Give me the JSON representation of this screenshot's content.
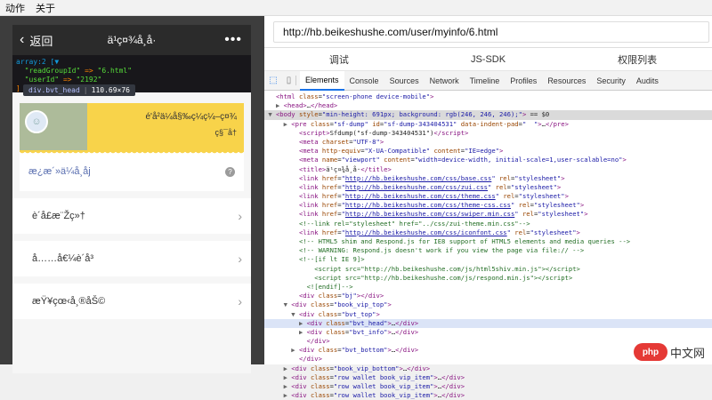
{
  "menubar": {
    "items": [
      "动作",
      "关于"
    ]
  },
  "phone": {
    "nav": {
      "back_label": "返回",
      "title": "ä¹ç¤¾å¸å·",
      "more": "•••"
    },
    "dump": {
      "header": "array:2 [▼",
      "line1_key": "\"readGroupId\"",
      "line1_val": "\"6.html\"",
      "line2_key": "\"userId\"",
      "line2_val": "\"2192\"",
      "close": "]"
    },
    "tooltip": {
      "tag": "div.bvt_head",
      "size": "110.69×76"
    },
    "vip": {
      "info_line1": "é'å²ä¼å§‰ç¼ç¼–ç¤¾",
      "info_line2": "ç§¯å†",
      "bottom_label": "æ¿æ´»ä¼å¸åj",
      "help": "?"
    },
    "rows": [
      {
        "label": "è´å£æ¨Žç»†"
      },
      {
        "label": "å……å€¼è´å³"
      },
      {
        "label": "æŸ¥çœ‹å¸®åŠ©"
      }
    ]
  },
  "browser": {
    "url": "http://hb.beikeshushe.com/user/myinfo/6.html",
    "tabs": [
      "调试",
      "JS-SDK",
      "权限列表"
    ],
    "devtools_tabs": [
      "Elements",
      "Console",
      "Sources",
      "Network",
      "Timeline",
      "Profiles",
      "Resources",
      "Security",
      "Audits"
    ],
    "code_lines": [
      {
        "indent": 0,
        "arrow": "",
        "html": "<span class='tg'>&lt;html</span> <span class='at'>class</span>=<span class='av'>\"screen-phone device-mobile\"</span><span class='tg'>&gt;</span>"
      },
      {
        "indent": 1,
        "arrow": "▶",
        "html": "<span class='tg'>&lt;head&gt;</span>…<span class='tg'>&lt;/head&gt;</span>"
      },
      {
        "indent": 0,
        "arrow": "▼",
        "cls": "sel",
        "html": "<span class='tg'>&lt;body</span> <span class='at'>style</span>=<span class='av'>\"min-height: 691px; background: rgb(246, 246, 246);\"</span><span class='tg'>&gt;</span> == $0"
      },
      {
        "indent": 2,
        "arrow": "▶",
        "html": "<span class='tg'>&lt;pre</span> <span class='at'>class</span>=<span class='av'>\"sf-dump\"</span> <span class='at'>id</span>=<span class='av'>\"sf-dump-343404531\"</span> <span class='at'>data-indent-pad</span>=<span class='av'>\"  \"</span><span class='tg'>&gt;</span>…<span class='tg'>&lt;/pre&gt;</span>"
      },
      {
        "indent": 3,
        "arrow": "",
        "html": "<span class='tg'>&lt;script&gt;</span>Sfdump(\"sf-dump-343404531\")<span class='tg'>&lt;/script&gt;</span>"
      },
      {
        "indent": 3,
        "arrow": "",
        "html": "<span class='tg'>&lt;meta</span> <span class='at'>charset</span>=<span class='av'>\"UTF-8\"</span><span class='tg'>&gt;</span>"
      },
      {
        "indent": 3,
        "arrow": "",
        "html": "<span class='tg'>&lt;meta</span> <span class='at'>http-equiv</span>=<span class='av'>\"X-UA-Compatible\"</span> <span class='at'>content</span>=<span class='av'>\"IE=edge\"</span><span class='tg'>&gt;</span>"
      },
      {
        "indent": 3,
        "arrow": "",
        "html": "<span class='tg'>&lt;meta</span> <span class='at'>name</span>=<span class='av'>\"viewport\"</span> <span class='at'>content</span>=<span class='av'>\"width=device-width, initial-scale=1,user-scalable=no\"</span><span class='tg'>&gt;</span>"
      },
      {
        "indent": 3,
        "arrow": "",
        "html": "<span class='tg'>&lt;title&gt;</span>ä¹ç¤¾å¸å·<span class='tg'>&lt;/title&gt;</span>"
      },
      {
        "indent": 3,
        "arrow": "",
        "html": "<span class='tg'>&lt;link</span> <span class='at'>href</span>=<span class='av'>\"</span><span class='lk'>http://hb.beikeshushe.com/css/base.css</span><span class='av'>\"</span> <span class='at'>rel</span>=<span class='av'>\"stylesheet\"</span><span class='tg'>&gt;</span>"
      },
      {
        "indent": 3,
        "arrow": "",
        "html": "<span class='tg'>&lt;link</span> <span class='at'>href</span>=<span class='av'>\"</span><span class='lk'>http://hb.beikeshushe.com/css/zui.css</span><span class='av'>\"</span> <span class='at'>rel</span>=<span class='av'>\"stylesheet\"</span><span class='tg'>&gt;</span>"
      },
      {
        "indent": 3,
        "arrow": "",
        "html": "<span class='tg'>&lt;link</span> <span class='at'>href</span>=<span class='av'>\"</span><span class='lk'>http://hb.beikeshushe.com/css/theme.css</span><span class='av'>\"</span> <span class='at'>rel</span>=<span class='av'>\"stylesheet\"</span><span class='tg'>&gt;</span>"
      },
      {
        "indent": 3,
        "arrow": "",
        "html": "<span class='tg'>&lt;link</span> <span class='at'>href</span>=<span class='av'>\"</span><span class='lk'>http://hb.beikeshushe.com/css/theme-css.css</span><span class='av'>\"</span> <span class='at'>rel</span>=<span class='av'>\"stylesheet\"</span><span class='tg'>&gt;</span>"
      },
      {
        "indent": 3,
        "arrow": "",
        "html": "<span class='tg'>&lt;link</span> <span class='at'>href</span>=<span class='av'>\"</span><span class='lk'>http://hb.beikeshushe.com/css/swiper.min.css</span><span class='av'>\"</span> <span class='at'>rel</span>=<span class='av'>\"stylesheet\"</span><span class='tg'>&gt;</span>"
      },
      {
        "indent": 3,
        "arrow": "",
        "html": "<span class='cm'>&lt;!--link rel=\"stylesheet\" href=\"../css/zui-theme.min.css\"--&gt;</span>"
      },
      {
        "indent": 3,
        "arrow": "",
        "html": "<span class='tg'>&lt;link</span> <span class='at'>href</span>=<span class='av'>\"</span><span class='lk'>http://hb.beikeshushe.com/css/iconfont.css</span><span class='av'>\"</span> <span class='at'>rel</span>=<span class='av'>\"stylesheet\"</span><span class='tg'>&gt;</span>"
      },
      {
        "indent": 3,
        "arrow": "",
        "html": "<span class='cm'>&lt;!-- HTML5 shim and Respond.js for IE8 support of HTML5 elements and media queries --&gt;</span>"
      },
      {
        "indent": 3,
        "arrow": "",
        "html": "<span class='cm'>&lt;!-- WARNING: Respond.js doesn't work if you view the page via file:// --&gt;</span>"
      },
      {
        "indent": 3,
        "arrow": "",
        "html": "<span class='cm'>&lt;!--[if lt IE 9]&gt;</span>"
      },
      {
        "indent": 5,
        "arrow": "",
        "html": "<span class='cm'>&lt;script src=\"http://hb.beikeshushe.com/js/html5shiv.min.js\"&gt;&lt;/script&gt;</span>"
      },
      {
        "indent": 5,
        "arrow": "",
        "html": "<span class='cm'>&lt;script src=\"http://hb.beikeshushe.com/js/respond.min.js\"&gt;&lt;/script&gt;</span>"
      },
      {
        "indent": 4,
        "arrow": "",
        "html": "<span class='cm'>&lt;![endif]--&gt;</span>"
      },
      {
        "indent": 3,
        "arrow": "",
        "html": "<span class='tg'>&lt;div</span> <span class='at'>class</span>=<span class='av'>\"bj\"</span><span class='tg'>&gt;&lt;/div&gt;</span>"
      },
      {
        "indent": 2,
        "arrow": "▼",
        "html": "<span class='tg'>&lt;div</span> <span class='at'>class</span>=<span class='av'>\"book_vip_top\"</span><span class='tg'>&gt;</span>"
      },
      {
        "indent": 3,
        "arrow": "▼",
        "html": "<span class='tg'>&lt;div</span> <span class='at'>class</span>=<span class='av'>\"bvt_top\"</span><span class='tg'>&gt;</span>"
      },
      {
        "indent": 4,
        "arrow": "▶",
        "cls": "hl",
        "html": "<span class='tg'>&lt;div</span> <span class='at'>class</span>=<span class='av'>\"bvt_head\"</span><span class='tg'>&gt;</span>…<span class='tg'>&lt;/div&gt;</span>"
      },
      {
        "indent": 4,
        "arrow": "▶",
        "html": "<span class='tg'>&lt;div</span> <span class='at'>class</span>=<span class='av'>\"bvt_info\"</span><span class='tg'>&gt;</span>…<span class='tg'>&lt;/div&gt;</span>"
      },
      {
        "indent": 4,
        "arrow": "",
        "html": "<span class='tg'>&lt;/div&gt;</span>"
      },
      {
        "indent": 3,
        "arrow": "▶",
        "html": "<span class='tg'>&lt;div</span> <span class='at'>class</span>=<span class='av'>\"bvt_bottom\"</span><span class='tg'>&gt;</span>…<span class='tg'>&lt;/div&gt;</span>"
      },
      {
        "indent": 3,
        "arrow": "",
        "html": "<span class='tg'>&lt;/div&gt;</span>"
      },
      {
        "indent": 2,
        "arrow": "▶",
        "html": "<span class='tg'>&lt;div</span> <span class='at'>class</span>=<span class='av'>\"book_vip_bottom\"</span><span class='tg'>&gt;</span>…<span class='tg'>&lt;/div&gt;</span>"
      },
      {
        "indent": 2,
        "arrow": "▶",
        "html": "<span class='tg'>&lt;div</span> <span class='at'>class</span>=<span class='av'>\"row wallet book_vip_item\"</span><span class='tg'>&gt;</span>…<span class='tg'>&lt;/div&gt;</span>"
      },
      {
        "indent": 2,
        "arrow": "▶",
        "html": "<span class='tg'>&lt;div</span> <span class='at'>class</span>=<span class='av'>\"row wallet book_vip_item\"</span><span class='tg'>&gt;</span>…<span class='tg'>&lt;/div&gt;</span>"
      },
      {
        "indent": 2,
        "arrow": "▶",
        "html": "<span class='tg'>&lt;div</span> <span class='at'>class</span>=<span class='av'>\"row wallet book_vip_item\"</span><span class='tg'>&gt;</span>…<span class='tg'>&lt;/div&gt;</span>"
      }
    ]
  },
  "watermark": {
    "logo": "php",
    "text": "中文网"
  }
}
